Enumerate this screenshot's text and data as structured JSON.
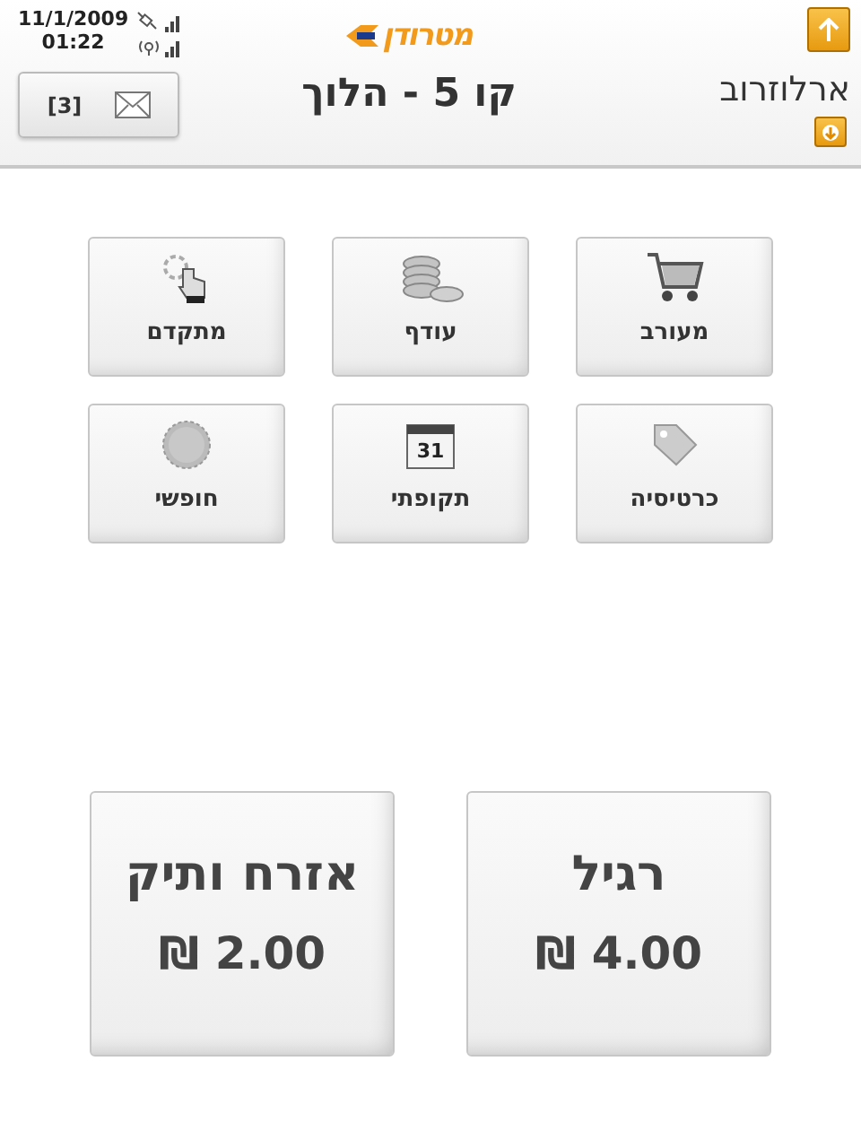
{
  "status": {
    "date": "11/1/2009",
    "time": "01:22"
  },
  "messages": {
    "count": "[3]"
  },
  "logo": {
    "text": "מטרודן"
  },
  "title": "קו 5 - הלוך",
  "station": {
    "name": "ארלוזרוב"
  },
  "ticket_types": [
    {
      "label": "מעורב",
      "kind": "cart"
    },
    {
      "label": "עודף",
      "kind": "coins"
    },
    {
      "label": "מתקדם",
      "kind": "advanced"
    },
    {
      "label": "כרטיסיה",
      "kind": "tag"
    },
    {
      "label": "תקופתי",
      "kind": "calendar",
      "icon_text": "31"
    },
    {
      "label": "חופשי",
      "kind": "seal"
    }
  ],
  "fares": [
    {
      "name": "רגיל",
      "price": "4.00 ₪"
    },
    {
      "name": "אזרח ותיק",
      "price": "2.00 ₪"
    }
  ]
}
